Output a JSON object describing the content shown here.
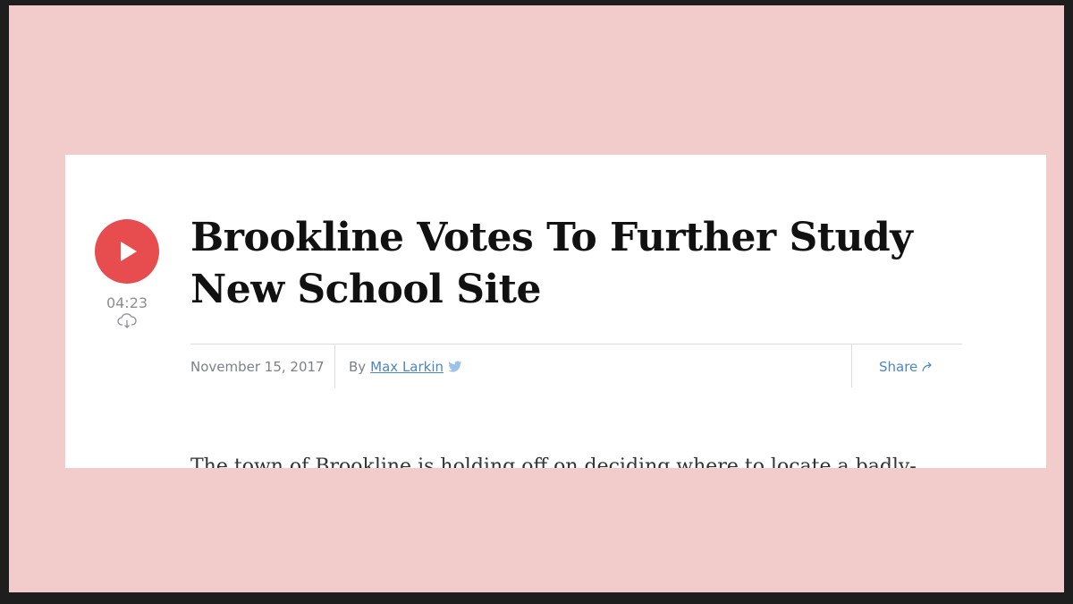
{
  "player": {
    "duration": "04:23"
  },
  "article": {
    "headline_line1": "Brookline Votes To Further Study",
    "headline_line2": "New School Site",
    "date": "November 15, 2017",
    "by_prefix": "By",
    "author": "Max Larkin",
    "share_label": "Share",
    "body_first_line": "The town of Brookline is holding off on deciding where to locate a badly-"
  },
  "colors": {
    "background": "#f2cbcb",
    "play_button": "#e74c4f",
    "link": "#4b86c6"
  },
  "icons": [
    "play-icon",
    "download-icon",
    "twitter-icon",
    "share-arrow-icon"
  ]
}
